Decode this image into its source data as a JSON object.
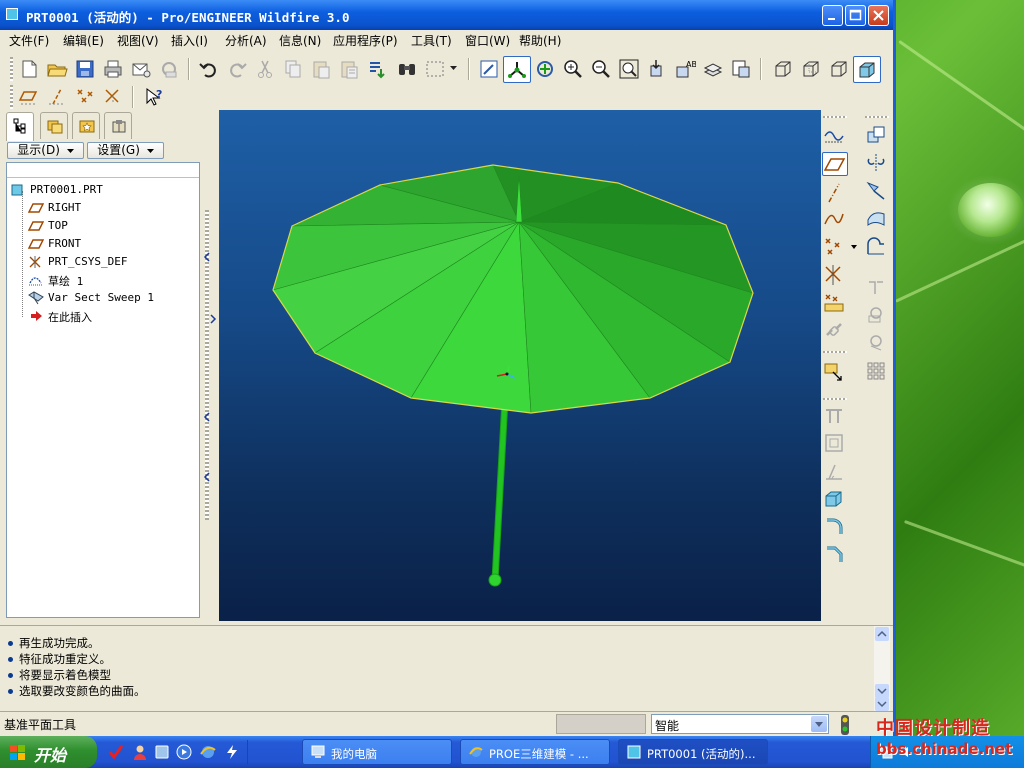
{
  "window": {
    "title": "PRT0001 (活动的) - Pro/ENGINEER Wildfire 3.0"
  },
  "menu": [
    {
      "label": "文件(F)"
    },
    {
      "label": "编辑(E)"
    },
    {
      "label": "视图(V)"
    },
    {
      "label": "插入(I)"
    },
    {
      "label": "分析(A)"
    },
    {
      "label": "信息(N)"
    },
    {
      "label": "应用程序(P)"
    },
    {
      "label": "工具(T)"
    },
    {
      "label": "窗口(W)"
    },
    {
      "label": "帮助(H)"
    }
  ],
  "navigator": {
    "show_label": "显示(D)",
    "settings_label": "设置(G)"
  },
  "model_tree": [
    {
      "label": "PRT0001.PRT",
      "icon": "part-icon"
    },
    {
      "label": "RIGHT",
      "icon": "datum-plane-icon"
    },
    {
      "label": "TOP",
      "icon": "datum-plane-icon"
    },
    {
      "label": "FRONT",
      "icon": "datum-plane-icon"
    },
    {
      "label": "PRT_CSYS_DEF",
      "icon": "csys-icon"
    },
    {
      "label": "草绘 1",
      "icon": "sketch-icon"
    },
    {
      "label": "Var Sect Sweep 1",
      "icon": "sweep-icon"
    },
    {
      "label": "在此插入",
      "icon": "insert-here-arrow-icon"
    }
  ],
  "messages": [
    {
      "text": "再生成功完成。"
    },
    {
      "text": "特征成功重定义。"
    },
    {
      "text": "将要显示着色模型"
    },
    {
      "text": "选取要改变颜色的曲面。"
    }
  ],
  "status": {
    "text": "基准平面工具",
    "filter_value": "智能"
  },
  "taskbar": {
    "start_label": "开始",
    "tasks": [
      {
        "label": "我的电脑"
      },
      {
        "label": "PROE三维建模 - ..."
      },
      {
        "label": "PRT0001 (活动的)..."
      }
    ]
  },
  "watermark": {
    "line1": "中国设计制造",
    "line2": "bbs.chinade.net"
  },
  "colors": {
    "title_bar": "#0d5fe0",
    "viewport_top": "#1e5fa6",
    "viewport_bottom": "#0a2148",
    "model_green": "#2fd42f",
    "edge_yellow": "#d8d84a"
  }
}
